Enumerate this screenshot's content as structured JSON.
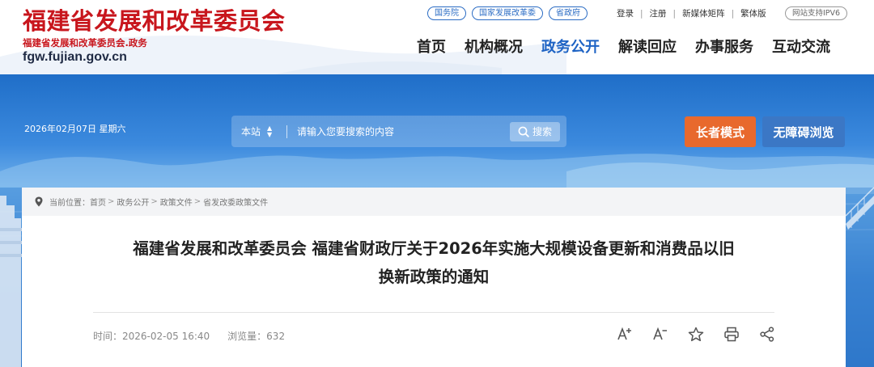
{
  "header": {
    "title": "福建省发展和改革委员会",
    "subtitle": "福建省发展和改革委员会.政务",
    "domain": "fgw.fujian.gov.cn",
    "portal_links": [
      "国务院",
      "国家发展改革委",
      "省政府"
    ],
    "util_links": [
      "登录",
      "注册",
      "新媒体矩阵",
      "繁体版"
    ],
    "ipv6_badge": "网站支持IPV6",
    "nav": [
      {
        "label": "首页",
        "active": false
      },
      {
        "label": "机构概况",
        "active": false
      },
      {
        "label": "政务公开",
        "active": true
      },
      {
        "label": "解读回应",
        "active": false
      },
      {
        "label": "办事服务",
        "active": false
      },
      {
        "label": "互动交流",
        "active": false
      }
    ]
  },
  "banner": {
    "date": "2026年02月07日 星期六",
    "search": {
      "scope": "本站",
      "placeholder": "请输入您要搜索的内容",
      "button": "搜索"
    },
    "elder_mode": "长者模式",
    "accessibility": "无障碍浏览"
  },
  "breadcrumb": {
    "label": "当前位置：",
    "items": [
      "首页",
      "政务公开",
      "政策文件",
      "省发改委政策文件"
    ]
  },
  "article": {
    "title_line1": "福建省发展和改革委员会 福建省财政厅关于2026年实施大规模设备更新和消费品以旧",
    "title_line2": "换新政策的通知",
    "time_label": "时间：",
    "time": "2026-02-05 16:40",
    "views_label": "浏览量：",
    "views": "632"
  },
  "colors": {
    "brand_red": "#c8161d",
    "active_blue": "#1e63c4",
    "elder_orange": "#e8692d",
    "access_blue": "#3b77c5"
  },
  "tools": [
    "font-increase-icon",
    "font-decrease-icon",
    "star-icon",
    "print-icon",
    "share-icon"
  ]
}
